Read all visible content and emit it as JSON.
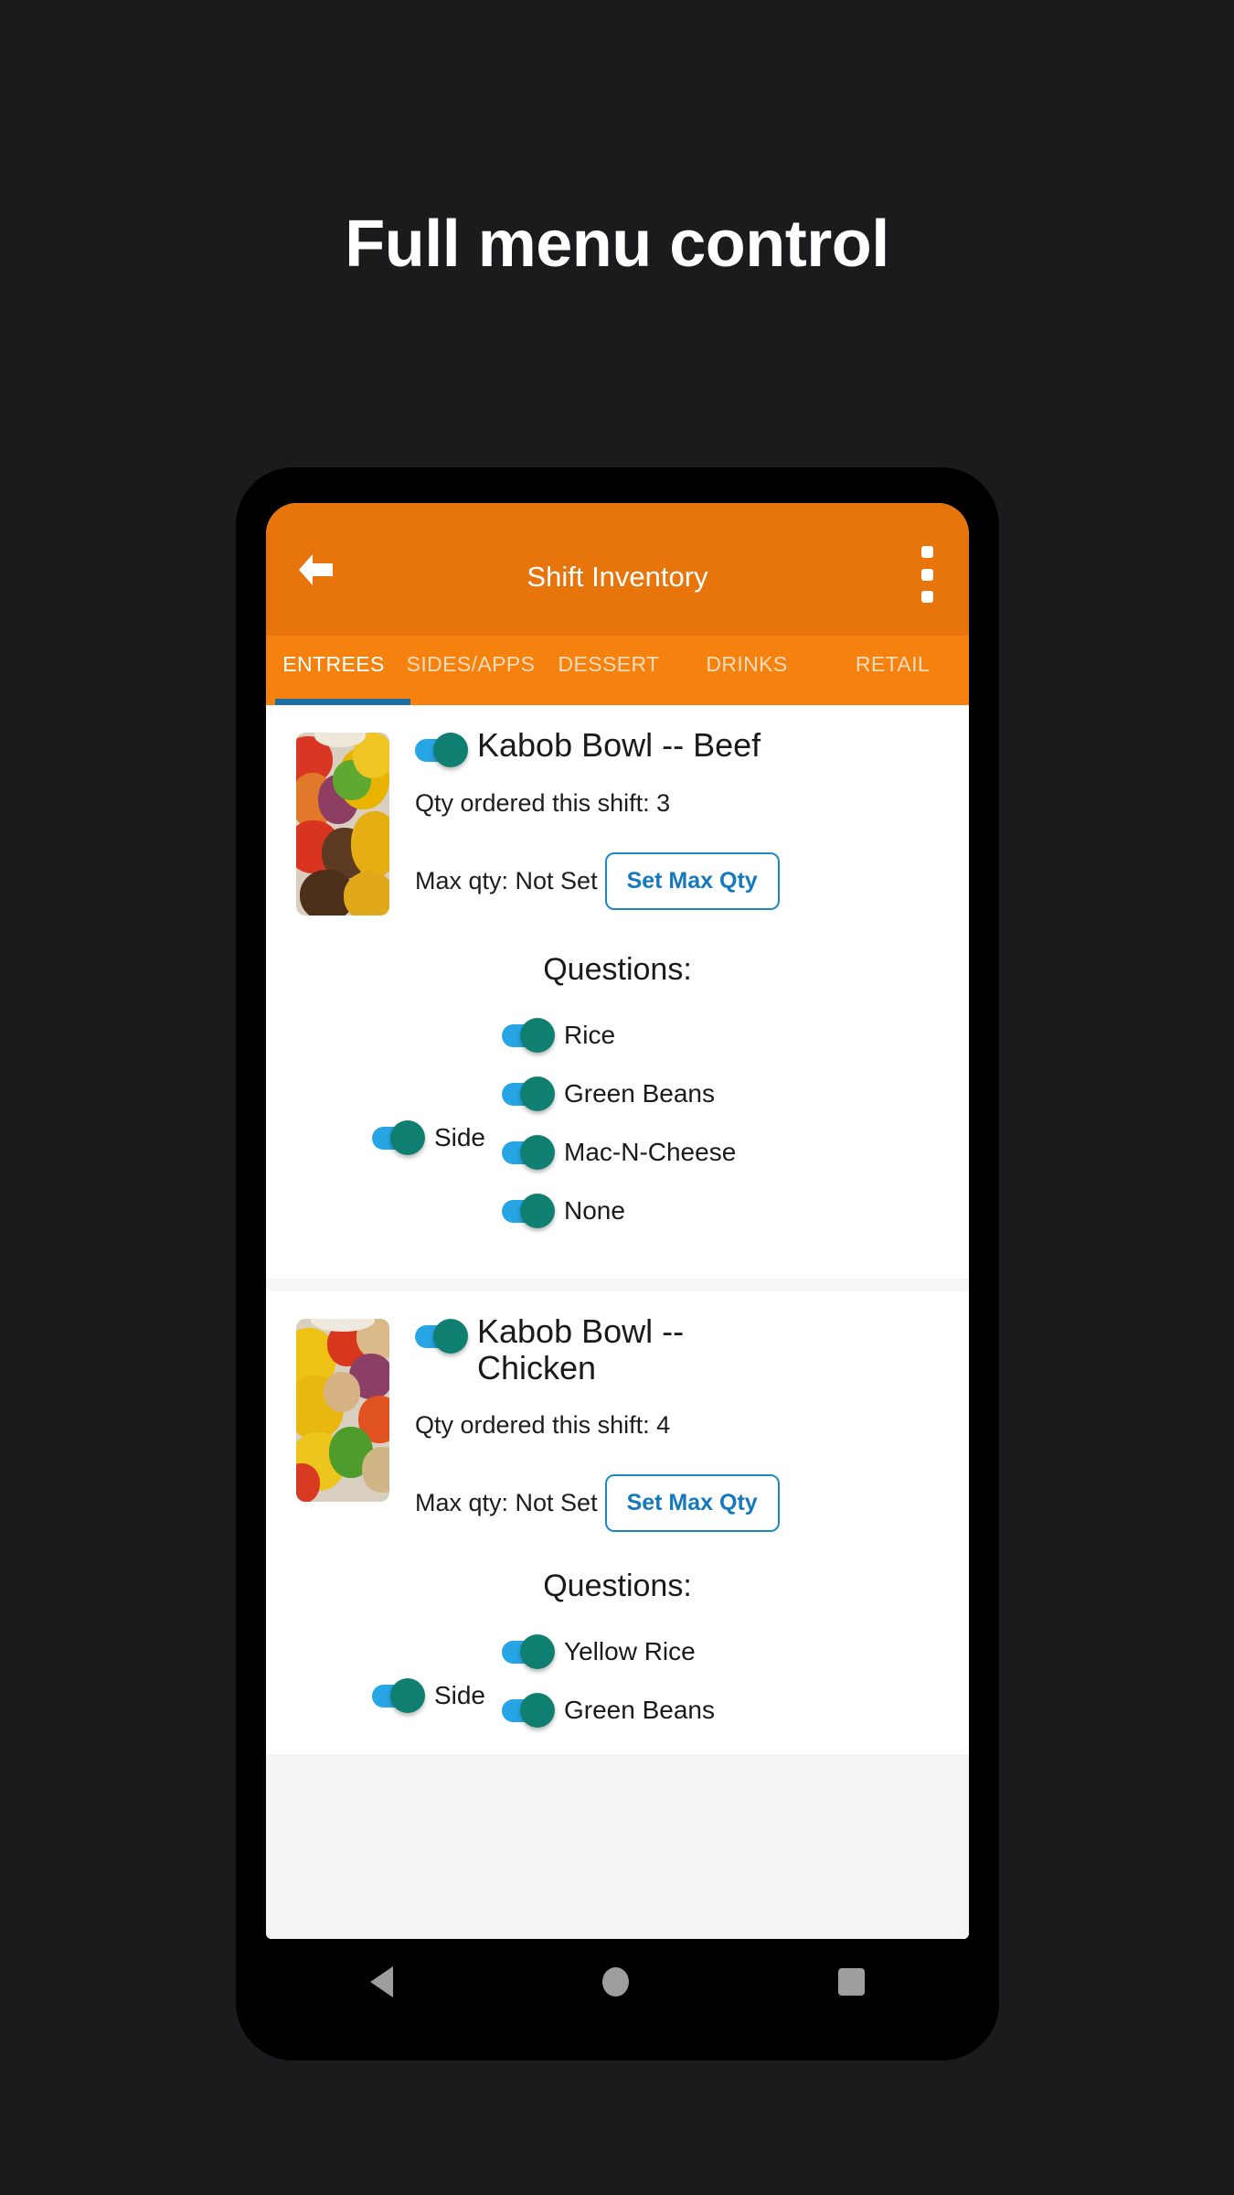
{
  "headline": "Full menu control",
  "app": {
    "toolbar": {
      "title": "Shift Inventory",
      "back_icon": "back-arrow-icon",
      "overflow_icon": "more-vert-icon"
    },
    "tabs": [
      {
        "label": "ENTREES",
        "active": true
      },
      {
        "label": "SIDES/APPS",
        "active": false
      },
      {
        "label": "DESSERT",
        "active": false
      },
      {
        "label": "DRINKS",
        "active": false
      },
      {
        "label": "RETAIL",
        "active": false
      }
    ],
    "accent_blue": "#1c6ea4",
    "toolbar_orange": "#e8740c",
    "tabbar_orange": "#f5820f",
    "toggle_on_color": "#0f7f72",
    "toggle_track_color": "#27a5e5",
    "items": [
      {
        "name": "Kabob Bowl -- Beef",
        "enabled": true,
        "qty_line": "Qty ordered this shift: 3",
        "max_qty_line": "Max qty: Not Set",
        "set_max_label": "Set Max Qty",
        "questions_label": "Questions:",
        "question_name": "Side",
        "options": [
          "Rice",
          "Green Beans",
          "Mac-N-Cheese",
          "None"
        ]
      },
      {
        "name": "Kabob Bowl -- Chicken",
        "enabled": true,
        "qty_line": "Qty ordered this shift: 4",
        "max_qty_line": "Max qty: Not Set",
        "set_max_label": "Set Max Qty",
        "questions_label": "Questions:",
        "question_name": "Side",
        "options": [
          "Yellow Rice",
          "Green Beans"
        ]
      }
    ],
    "navbar": {
      "back": "nav-back-icon",
      "home": "nav-home-icon",
      "recents": "nav-recents-icon"
    }
  }
}
